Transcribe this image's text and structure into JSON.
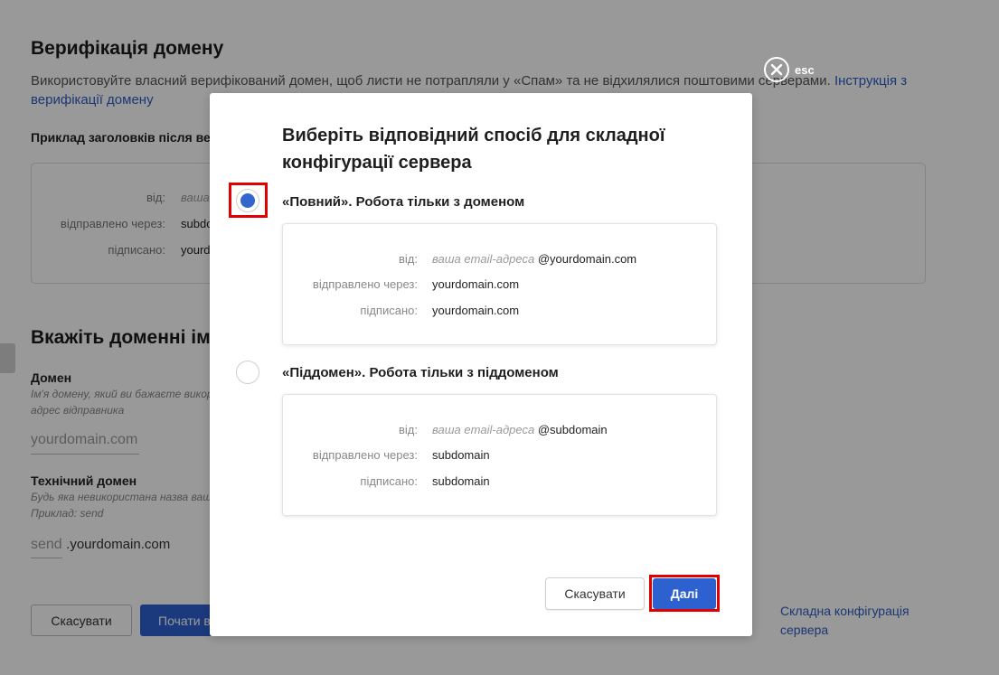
{
  "background": {
    "title": "Верифікація домену",
    "description": "Використовуйте власний верифікований домен, щоб листи не потрапляли у «Спам» та не відхилялися поштовими серверами.",
    "description_link": "Інструкція з верифікації домену",
    "example_heading": "Приклад заголовків після вер",
    "example": {
      "from_label": "від:",
      "from_value": "ваша",
      "via_label": "відправлено через:",
      "via_value": "subdo",
      "signed_label": "підписано:",
      "signed_value": "yourd"
    },
    "section_title": "Вкажіть доменні іме",
    "domain_label": "Домен",
    "domain_hint": "Ім'я домену, який ви бажаєте викор адрес відправника",
    "domain_placeholder": "yourdomain.com",
    "tech_domain_label": "Технічний домен",
    "tech_domain_hint": "Будь яка невикористана назва ваш Приклад: send",
    "tech_domain_placeholder": "send",
    "tech_domain_suffix": ".yourdomain.com",
    "cancel_label": "Скасувати",
    "start_label": "Почати в",
    "complex_link": "Складна конфігурація сервера"
  },
  "esc_label": "esc",
  "modal": {
    "title": "Виберіть відповідний спосіб для складної конфігурації сервера",
    "options": [
      {
        "title": "«Повний». Робота тільки з доменом",
        "checked": true,
        "from_label": "від:",
        "from_placeholder": "ваша email-адреса",
        "from_domain": "@yourdomain.com",
        "via_label": "відправлено через:",
        "via_value": "yourdomain.com",
        "signed_label": "підписано:",
        "signed_value": "yourdomain.com"
      },
      {
        "title": "«Піддомен». Робота тільки з піддоменом",
        "checked": false,
        "from_label": "від:",
        "from_placeholder": "ваша email-адреса",
        "from_domain": "@subdomain",
        "via_label": "відправлено через:",
        "via_value": "subdomain",
        "signed_label": "підписано:",
        "signed_value": "subdomain"
      }
    ],
    "cancel_label": "Скасувати",
    "next_label": "Далі"
  },
  "colors": {
    "accent": "#2d61d0",
    "link": "#2c5cc5",
    "highlight": "#e00000",
    "overlay": "rgba(0,0,0,0.40)"
  }
}
